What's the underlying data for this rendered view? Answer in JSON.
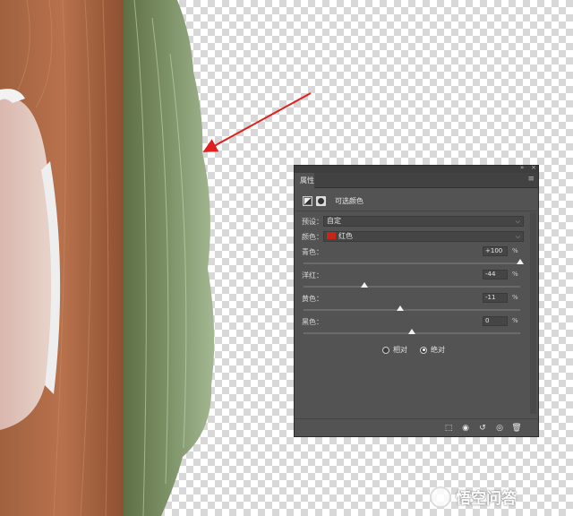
{
  "panel": {
    "tab_label": "属性",
    "adjustment_title": "可选颜色",
    "preset_label": "预设：",
    "preset_value": "自定",
    "color_label": "颜色：",
    "color_value": "红色",
    "color_swatch": "#c1281b",
    "sliders": [
      {
        "label": "青色：",
        "value": "+100",
        "unit": "%",
        "level": 1.0
      },
      {
        "label": "洋红：",
        "value": "-44",
        "unit": "%",
        "level": 0.28
      },
      {
        "label": "黄色：",
        "value": "-11",
        "unit": "%",
        "level": 0.445
      },
      {
        "label": "黑色：",
        "value": "0",
        "unit": "%",
        "level": 0.5
      }
    ],
    "mode_relative": "相对",
    "mode_absolute": "绝对",
    "mode_selected": "绝对"
  },
  "watermark": "悟空问答",
  "colors": {
    "panel_bg": "#535353",
    "arrow": "#e02020"
  }
}
